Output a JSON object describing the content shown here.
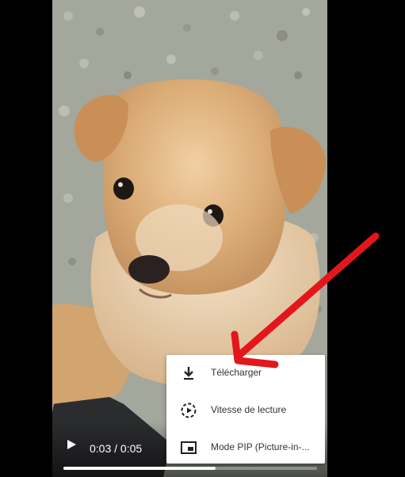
{
  "player": {
    "time_display": "0:03 / 0:05",
    "progress": 0.6
  },
  "menu": {
    "items": [
      {
        "label": "Télécharger",
        "icon": "download-icon"
      },
      {
        "label": "Vitesse de lecture",
        "icon": "playback-speed-icon"
      },
      {
        "label": "Mode PIP (Picture-in-...",
        "icon": "picture-in-picture-icon"
      }
    ]
  },
  "colors": {
    "annotation_arrow": "#e3161b",
    "menu_background": "#ffffff"
  }
}
